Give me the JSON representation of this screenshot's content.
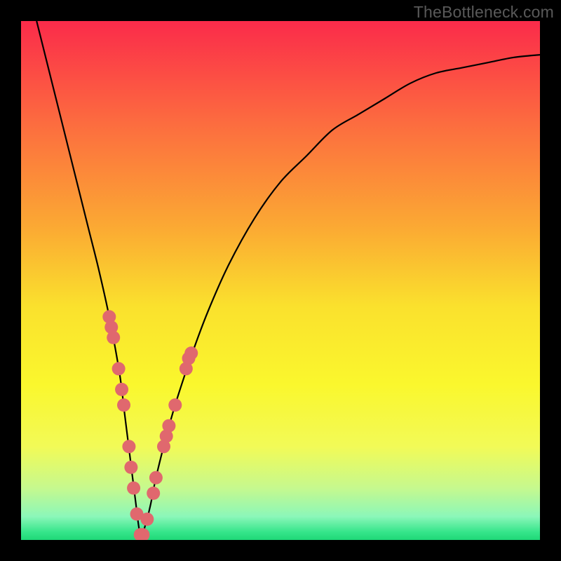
{
  "watermark": "TheBottleneck.com",
  "colors": {
    "frame": "#000000",
    "curve": "#000000",
    "marker_fill": "#e0686e",
    "marker_stroke": "#c8575e"
  },
  "gradient_stops": [
    {
      "offset": 0.0,
      "color": "#fb2b4a"
    },
    {
      "offset": 0.2,
      "color": "#fc6d3f"
    },
    {
      "offset": 0.4,
      "color": "#fbaa33"
    },
    {
      "offset": 0.55,
      "color": "#fae12d"
    },
    {
      "offset": 0.7,
      "color": "#faf72d"
    },
    {
      "offset": 0.82,
      "color": "#f2fa57"
    },
    {
      "offset": 0.9,
      "color": "#c6f98e"
    },
    {
      "offset": 0.955,
      "color": "#8bf7b9"
    },
    {
      "offset": 0.985,
      "color": "#35e58a"
    },
    {
      "offset": 1.0,
      "color": "#1fd877"
    }
  ],
  "chart_data": {
    "type": "line",
    "title": "",
    "xlabel": "",
    "ylabel": "",
    "xlim": [
      0,
      100
    ],
    "ylim": [
      0,
      100
    ],
    "x_optimum": 23,
    "series": [
      {
        "name": "bottleneck-curve",
        "x": [
          3,
          5,
          7,
          9,
          11,
          13,
          15,
          17,
          19,
          20,
          21,
          22,
          23,
          24,
          25,
          26,
          28,
          30,
          33,
          36,
          40,
          45,
          50,
          55,
          60,
          65,
          70,
          75,
          80,
          85,
          90,
          95,
          100
        ],
        "y": [
          100,
          92,
          84,
          76,
          68,
          60,
          52,
          43,
          32,
          24,
          16,
          8,
          1,
          3,
          7,
          12,
          20,
          27,
          36,
          44,
          53,
          62,
          69,
          74,
          79,
          82,
          85,
          88,
          90,
          91,
          92,
          93,
          93.5
        ]
      }
    ],
    "markers": {
      "name": "highlighted-points",
      "points": [
        {
          "x": 17.0,
          "y": 43
        },
        {
          "x": 17.4,
          "y": 41
        },
        {
          "x": 17.8,
          "y": 39
        },
        {
          "x": 18.8,
          "y": 33
        },
        {
          "x": 19.4,
          "y": 29
        },
        {
          "x": 19.8,
          "y": 26
        },
        {
          "x": 20.8,
          "y": 18
        },
        {
          "x": 21.2,
          "y": 14
        },
        {
          "x": 21.7,
          "y": 10
        },
        {
          "x": 22.3,
          "y": 5
        },
        {
          "x": 23.0,
          "y": 1
        },
        {
          "x": 23.5,
          "y": 1
        },
        {
          "x": 24.3,
          "y": 4
        },
        {
          "x": 25.5,
          "y": 9
        },
        {
          "x": 26.0,
          "y": 12
        },
        {
          "x": 27.5,
          "y": 18
        },
        {
          "x": 28.0,
          "y": 20
        },
        {
          "x": 28.5,
          "y": 22
        },
        {
          "x": 29.7,
          "y": 26
        },
        {
          "x": 31.8,
          "y": 33
        },
        {
          "x": 32.3,
          "y": 35
        },
        {
          "x": 32.8,
          "y": 36
        }
      ]
    }
  }
}
